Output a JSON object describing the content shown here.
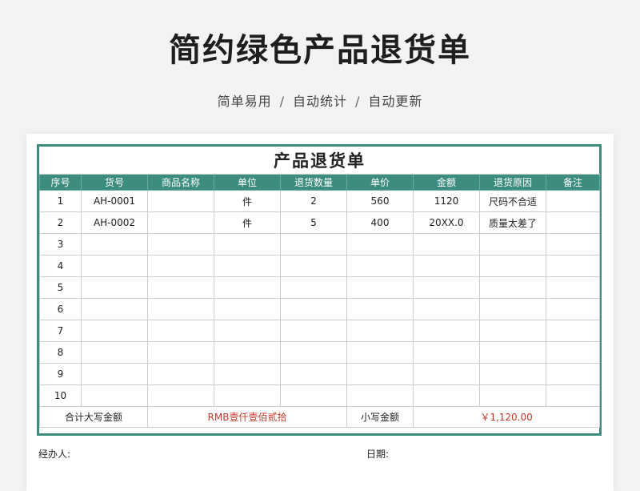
{
  "hero": {
    "title": "简约绿色产品退货单",
    "tags": [
      "简单易用",
      "自动统计",
      "自动更新"
    ],
    "separator": "/"
  },
  "sheet": {
    "title": "产品退货单",
    "columns": [
      "序号",
      "货号",
      "商品名称",
      "单位",
      "退货数量",
      "单价",
      "金额",
      "退货原因",
      "备注"
    ],
    "rows": [
      [
        "1",
        "AH-0001",
        "",
        "件",
        "2",
        "560",
        "1120",
        "尺码不合适",
        ""
      ],
      [
        "2",
        "AH-0002",
        "",
        "件",
        "5",
        "400",
        "20XX.0",
        "质量太差了",
        ""
      ],
      [
        "3",
        "",
        "",
        "",
        "",
        "",
        "",
        "",
        ""
      ],
      [
        "4",
        "",
        "",
        "",
        "",
        "",
        "",
        "",
        ""
      ],
      [
        "5",
        "",
        "",
        "",
        "",
        "",
        "",
        "",
        ""
      ],
      [
        "6",
        "",
        "",
        "",
        "",
        "",
        "",
        "",
        ""
      ],
      [
        "7",
        "",
        "",
        "",
        "",
        "",
        "",
        "",
        ""
      ],
      [
        "8",
        "",
        "",
        "",
        "",
        "",
        "",
        "",
        ""
      ],
      [
        "9",
        "",
        "",
        "",
        "",
        "",
        "",
        "",
        ""
      ],
      [
        "10",
        "",
        "",
        "",
        "",
        "",
        "",
        "",
        ""
      ]
    ],
    "total": {
      "upper_label": "合计大写金额",
      "upper_value": "RMB壹仟壹佰贰拾",
      "lower_label": "小写金额",
      "lower_value": "￥1,120.00"
    },
    "footer": {
      "handler_label": "经办人:",
      "date_label": "日期:"
    }
  },
  "colors": {
    "accent": "#3c8c80",
    "amount_text": "#c0392b",
    "background": "#f2f3f5"
  }
}
